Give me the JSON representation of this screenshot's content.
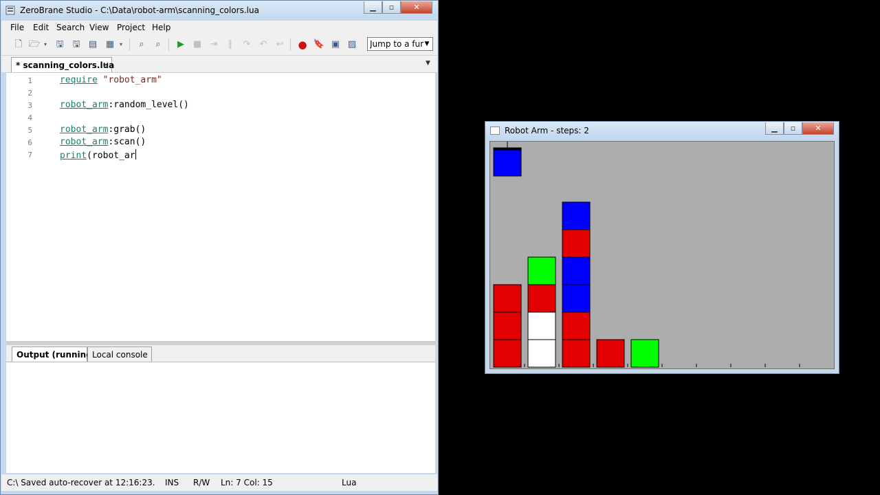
{
  "ide": {
    "title": "ZeroBrane Studio - C:\\Data\\robot-arm\\scanning_colors.lua",
    "menu": [
      "File",
      "Edit",
      "Search",
      "View",
      "Project",
      "Help"
    ],
    "toolbar": {
      "icons": [
        "new-file-icon",
        "open-file-icon",
        "save-icon",
        "save-all-icon",
        "project-dir-icon",
        "find-icon",
        "replace-icon",
        "run-icon",
        "stop-icon",
        "step-into-icon",
        "step-over-icon",
        "step-out-icon",
        "break-icon",
        "toggle-breakpoint-icon",
        "bookmark-icon",
        "preview-icon",
        "console-icon"
      ],
      "jump_value": "Jump to a func"
    },
    "tab": {
      "label": "* scanning_colors.lua",
      "close": "×"
    },
    "code_lines": [
      {
        "n": "1",
        "parts": [
          {
            "t": "require",
            "c": "kw"
          },
          {
            "t": " ",
            "c": ""
          },
          {
            "t": "\"robot_arm\"",
            "c": "str"
          }
        ]
      },
      {
        "n": "2",
        "parts": []
      },
      {
        "n": "3",
        "parts": [
          {
            "t": "robot_arm",
            "c": "ident"
          },
          {
            "t": ":random_level()",
            "c": ""
          }
        ]
      },
      {
        "n": "4",
        "parts": []
      },
      {
        "n": "5",
        "parts": [
          {
            "t": "robot_arm",
            "c": "ident"
          },
          {
            "t": ":grab()",
            "c": ""
          }
        ]
      },
      {
        "n": "6",
        "parts": [
          {
            "t": "robot_arm",
            "c": "ident"
          },
          {
            "t": ":scan()",
            "c": ""
          }
        ]
      },
      {
        "n": "7",
        "parts": [
          {
            "t": "print",
            "c": "kw"
          },
          {
            "t": "(robot_ar",
            "c": ""
          }
        ]
      }
    ],
    "output_tabs": [
      {
        "label": "Output (running)",
        "active": true
      },
      {
        "label": "Local console",
        "active": false
      }
    ],
    "status": {
      "message": "C:\\ Saved auto-recover at 12:16:23.",
      "mode": "INS",
      "access": "R/W",
      "position": "Ln: 7 Col: 15",
      "language": "Lua"
    }
  },
  "robot": {
    "title": "Robot Arm - steps: 2",
    "colors": {
      "red": "#e30000",
      "blue": "#0000ff",
      "green": "#00ff00",
      "white": "#ffffff"
    },
    "held_block": "blue",
    "stacks": [
      [
        "red",
        "red",
        "red"
      ],
      [
        "white",
        "white",
        "red",
        "green"
      ],
      [
        "red",
        "red",
        "blue",
        "blue",
        "red",
        "blue"
      ],
      [
        "red"
      ],
      [
        "green"
      ],
      [],
      [],
      [],
      [],
      []
    ]
  }
}
